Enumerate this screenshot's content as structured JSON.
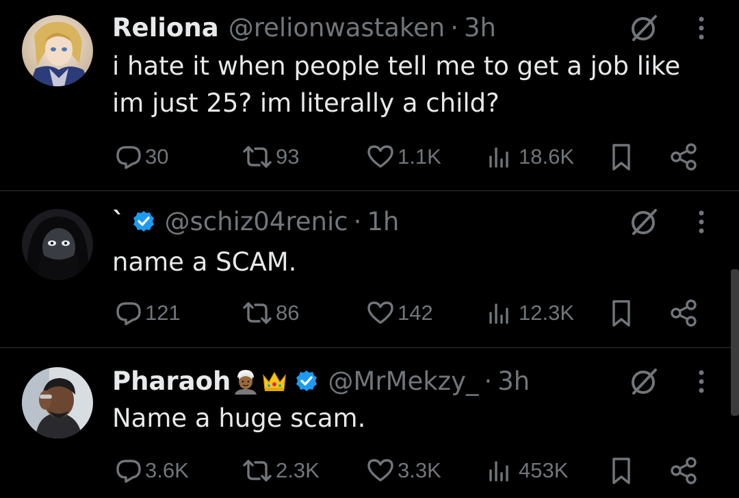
{
  "tweets": [
    {
      "display_name": "Reliona",
      "handle": "@relionwastaken",
      "separator": "·",
      "time": "3h",
      "text_lines": [
        "i hate it when people tell me to get a job like",
        "im just 25? im literally a child?"
      ],
      "replies": "30",
      "reposts": "93",
      "likes": "1.1K",
      "views": "18.6K",
      "verified": false
    },
    {
      "display_name": "`",
      "handle": "@schiz04renic",
      "separator": "·",
      "time": "1h",
      "text_lines": [
        "name a SCAM."
      ],
      "replies": "121",
      "reposts": "86",
      "likes": "142",
      "views": "12.3K",
      "verified": true
    },
    {
      "display_name": "Pharaoh",
      "handle": "@MrMekzy_",
      "separator": "·",
      "time": "3h",
      "text_lines": [
        "Name a huge scam."
      ],
      "replies": "3.6K",
      "reposts": "2.3K",
      "likes": "3.3K",
      "views": "453K",
      "verified": true,
      "emojis": [
        "man-with-turban-emoji",
        "crown-emoji"
      ]
    }
  ],
  "icons": {
    "reply": "reply-icon",
    "repost": "repost-icon",
    "like": "like-icon",
    "views": "views-icon",
    "bookmark": "bookmark-icon",
    "share": "share-icon",
    "grok": "grok-icon",
    "more": "more-icon",
    "verified": "verified-badge-icon"
  },
  "colors": {
    "background": "#000000",
    "text": "#e7e9ea",
    "muted": "#71767b",
    "verified": "#1d9bf0",
    "divider": "#2f3336"
  }
}
